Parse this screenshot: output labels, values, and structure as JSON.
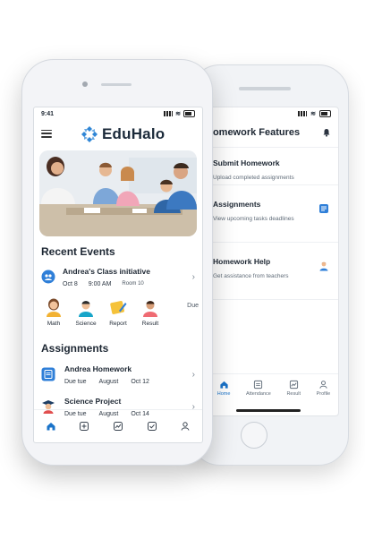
{
  "status": {
    "time": "9:41"
  },
  "front": {
    "app_name": "EduHalo",
    "recent_events_title": "Recent Events",
    "event": {
      "title": "Andrea's Class initiative",
      "date": "Oct 8",
      "time": "9:00 AM",
      "room": "Room 10"
    },
    "subjects": [
      {
        "label": "Math",
        "icon": "math-teacher-avatar"
      },
      {
        "label": "Science",
        "icon": "science-student-avatar"
      },
      {
        "label": "Report",
        "icon": "report-note-icon"
      },
      {
        "label": "Result",
        "icon": "result-student-avatar"
      }
    ],
    "due_label": "Due",
    "assignments_title": "Assignments",
    "assignments": [
      {
        "title": "Andrea Homework",
        "due": "Due tue",
        "month": "August",
        "date": "Oct 12"
      },
      {
        "title": "Science Project",
        "due": "Due tue",
        "month": "August",
        "date": "Oct 14"
      }
    ],
    "tabs": [
      "home-icon",
      "add-icon",
      "chart-icon",
      "check-icon",
      "profile-icon"
    ]
  },
  "back": {
    "title": "Homework Features",
    "features": [
      {
        "title": "Submit Homework",
        "desc": "Upload completed assignments"
      },
      {
        "title": "Assignments",
        "desc": "View upcoming tasks deadlines"
      },
      {
        "title": "Homework Help",
        "desc": "Get assistance from teachers"
      }
    ],
    "tabs": [
      {
        "label": "Home",
        "icon": "home-icon"
      },
      {
        "label": "Attendance",
        "icon": "attendance-icon"
      },
      {
        "label": "Result",
        "icon": "result-icon"
      },
      {
        "label": "Profile",
        "icon": "profile-icon"
      }
    ]
  },
  "colors": {
    "accent": "#1a73c9",
    "text": "#1d2733"
  }
}
